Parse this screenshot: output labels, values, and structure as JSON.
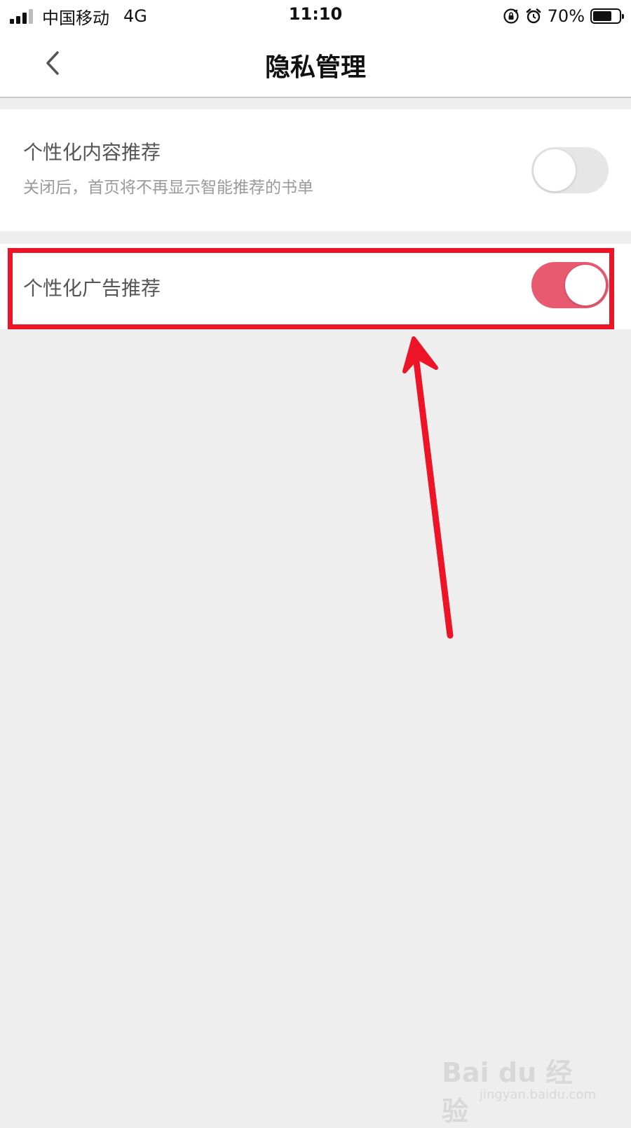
{
  "status_bar": {
    "carrier": "中国移动",
    "network": "4G",
    "time": "11:10",
    "battery": "70%",
    "icons": [
      "signal-icon",
      "rotation-lock-icon",
      "alarm-icon",
      "battery-icon"
    ]
  },
  "nav": {
    "title": "隐私管理",
    "back_icon": "chevron-left-icon"
  },
  "settings": [
    {
      "title": "个性化内容推荐",
      "subtitle": "关闭后，首页将不再显示智能推荐的书单",
      "enabled": false
    },
    {
      "title": "个性化广告推荐",
      "enabled": true
    }
  ],
  "colors": {
    "toggle_on": "#e85a70",
    "toggle_off": "#e6e6e6",
    "annotation": "#ee1428",
    "background": "#eeeeee"
  },
  "watermark": {
    "logo": "Bai du 经验",
    "url": "jingyan.baidu.com"
  }
}
